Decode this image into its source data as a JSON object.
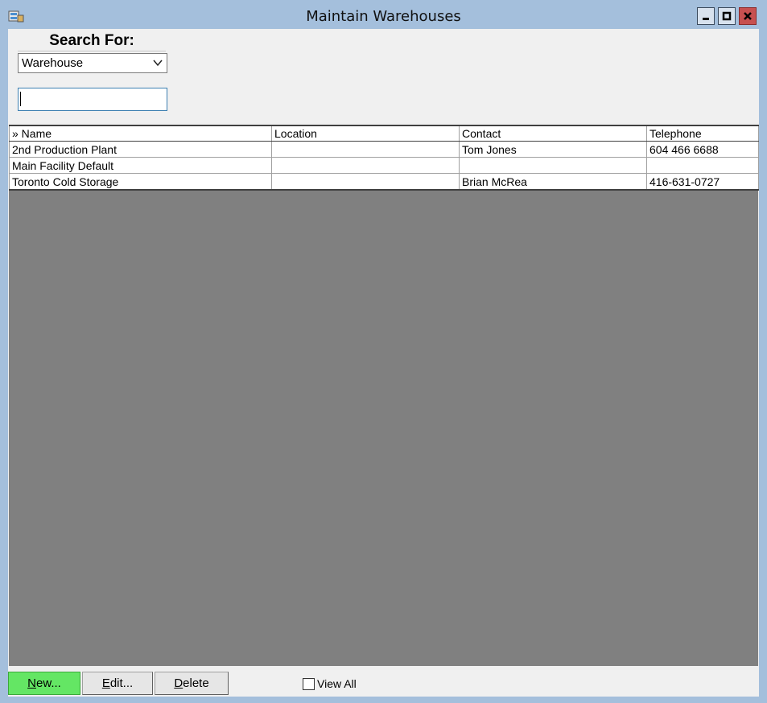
{
  "window": {
    "title": "Maintain Warehouses"
  },
  "search": {
    "label": "Search For:",
    "field_selected": "Warehouse",
    "input_value": ""
  },
  "table": {
    "columns": [
      "» Name",
      "Location",
      "Contact",
      "Telephone"
    ],
    "rows": [
      {
        "name": "2nd Production Plant",
        "location": "",
        "contact": "Tom Jones",
        "telephone": "604 466 6688"
      },
      {
        "name": "Main Facility Default",
        "location": "",
        "contact": "",
        "telephone": ""
      },
      {
        "name": "Toronto Cold Storage",
        "location": "",
        "contact": "Brian McRea",
        "telephone": "416-631-0727"
      }
    ]
  },
  "buttons": {
    "new_first": "N",
    "new_rest": "ew...",
    "edit_first": "E",
    "edit_rest": "dit...",
    "delete_first": "D",
    "delete_rest": "elete"
  },
  "view_all": {
    "label": "View All",
    "checked": false
  },
  "colors": {
    "new_button": "#64e664",
    "grid_background": "#808080",
    "frame": "#a4bfdc",
    "close_button": "#c75050"
  }
}
